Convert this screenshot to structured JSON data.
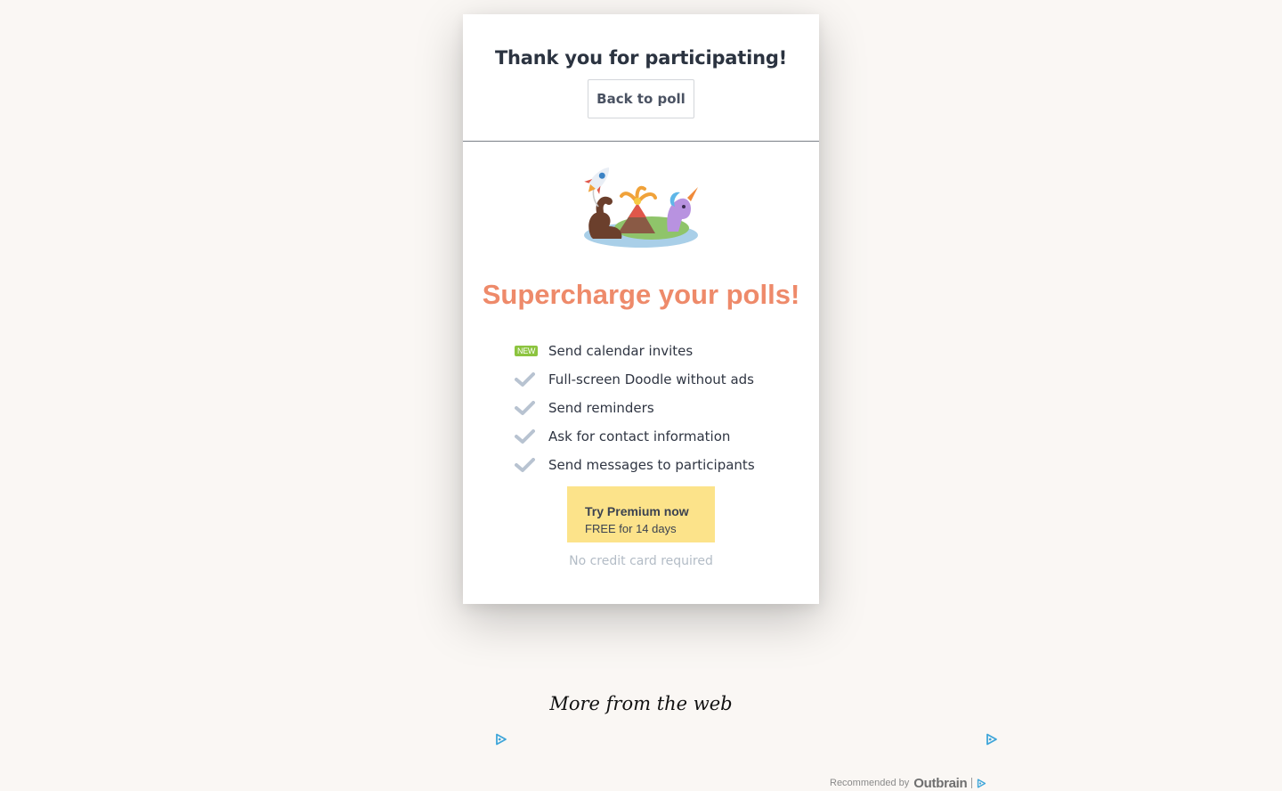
{
  "confirmation": {
    "title": "Thank you for participating!",
    "back_label": "Back to poll"
  },
  "promo": {
    "headline": "Supercharge your polls!",
    "new_badge": "NEW",
    "features": [
      {
        "label": "Send calendar invites",
        "icon": "new-badge"
      },
      {
        "label": "Full-screen Doodle without ads",
        "icon": "check-icon"
      },
      {
        "label": "Send reminders",
        "icon": "check-icon"
      },
      {
        "label": "Ask for contact information",
        "icon": "check-icon"
      },
      {
        "label": "Send messages to participants",
        "icon": "check-icon"
      }
    ],
    "cta_title": "Try Premium now",
    "cta_subtitle": "FREE for 14 days",
    "note": "No credit card required"
  },
  "recommendations": {
    "heading": "More from the web",
    "recommended_by": "Recommended by",
    "brand": "Outbrain"
  },
  "colors": {
    "background": "#faf7f4",
    "headline": "#ee8a6a",
    "cta": "#fce38a",
    "new_badge": "#8cc43f",
    "check": "#b8c3d1",
    "adchoices": "#3ea5d9"
  }
}
